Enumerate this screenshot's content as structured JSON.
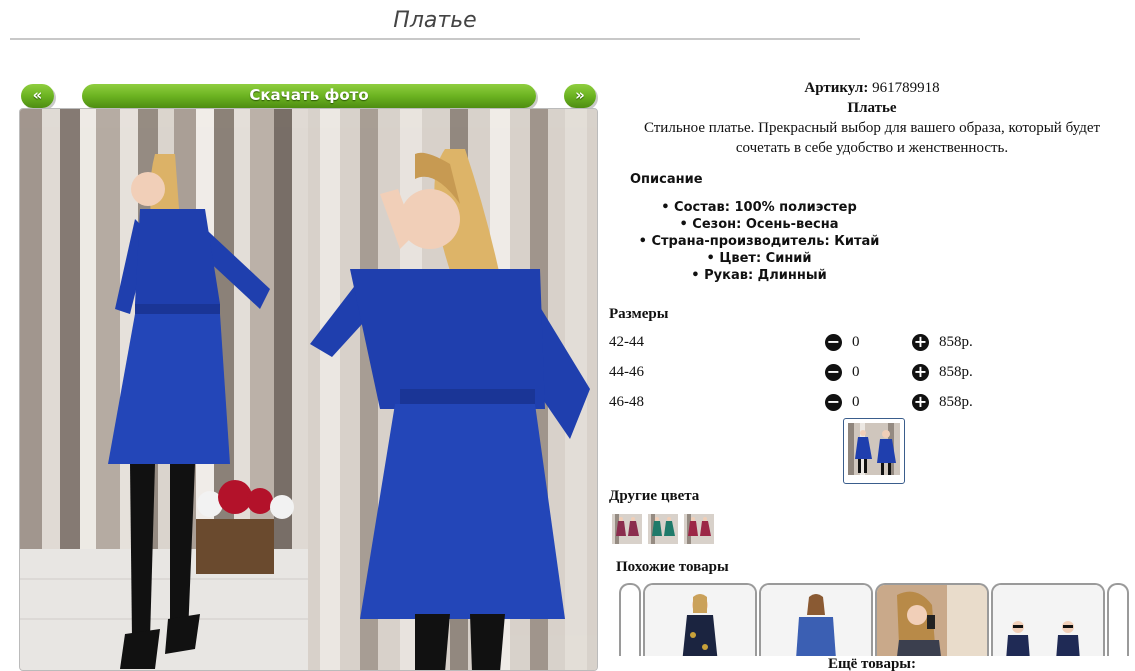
{
  "page": {
    "title": "Платье"
  },
  "gallery": {
    "prev_label": "«",
    "download_label": "Скачать фото",
    "next_label": "»"
  },
  "product": {
    "sku_label": "Артикул:",
    "sku": "961789918",
    "name": "Платье",
    "description": "Стильное платье. Прекрасный выбор для вашего образа, который будет сочетать в себе удобство и женственность.",
    "details_heading": "Описание",
    "properties": [
      "Состав: 100% полиэстер",
      "Сезон: Осень-весна",
      "Страна-производитель: Китай",
      "Цвет: Синий",
      "Рукав: Длинный"
    ]
  },
  "sizes": {
    "heading": "Размеры",
    "rows": [
      {
        "size": "42-44",
        "qty": "0",
        "price": "858р."
      },
      {
        "size": "44-46",
        "qty": "0",
        "price": "858р."
      },
      {
        "size": "46-48",
        "qty": "0",
        "price": "858р."
      }
    ]
  },
  "other_colors": {
    "heading": "Другие цвета",
    "swatches": [
      "#8b2d4e",
      "#1f7a6a",
      "#9c2747"
    ]
  },
  "similar": {
    "heading": "Похожие товары"
  },
  "more": {
    "heading": "Ещё товары:"
  },
  "colors": {
    "accent_green": "#6bb321",
    "dress_blue": "#1f3fae"
  }
}
